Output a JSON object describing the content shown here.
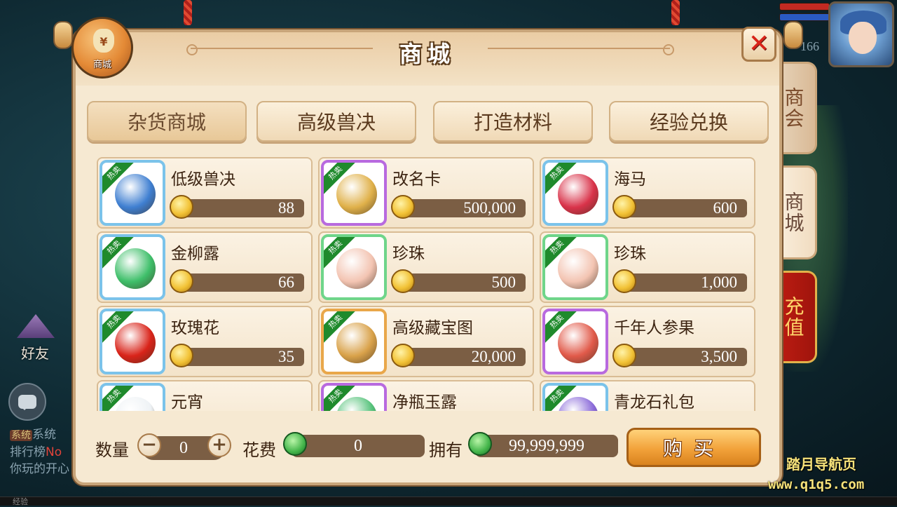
{
  "hud": {
    "level": "166"
  },
  "left_overlay": {
    "friend_label": "好友",
    "chat_lines": [
      {
        "tag": "系统",
        "text": "系统"
      },
      {
        "prefix": "排行榜",
        "highlight": "No"
      },
      {
        "text": "你玩的开心"
      }
    ]
  },
  "watermark": {
    "line1": "踏月导航页",
    "line2": "www.q1q5.com"
  },
  "exp_label": "经验",
  "shop": {
    "title": "商城",
    "badge": {
      "symbol": "¥",
      "label": "商城"
    },
    "close": "✕",
    "categories": [
      "杂货商城",
      "高级兽决",
      "打造材料",
      "经验兑换"
    ],
    "side_tabs": [
      "商会",
      "商城",
      "充值"
    ],
    "hot_tag": "热卖",
    "items": [
      {
        "name": "低级兽决",
        "price": "88",
        "frame": "blue",
        "icon": "beast-book-icon",
        "color": "#3f7fd1"
      },
      {
        "name": "改名卡",
        "price": "500,000",
        "frame": "purple",
        "icon": "scroll-icon",
        "color": "#e0b14a"
      },
      {
        "name": "海马",
        "price": "600",
        "frame": "blue",
        "icon": "seahorse-icon",
        "color": "#d9334a"
      },
      {
        "name": "金柳露",
        "price": "66",
        "frame": "blue",
        "icon": "potion-gourd-icon",
        "color": "#3fbf6a"
      },
      {
        "name": "珍珠",
        "price": "500",
        "frame": "green",
        "icon": "pearl-icon",
        "color": "#f3c4b2"
      },
      {
        "name": "珍珠",
        "price": "1,000",
        "frame": "green",
        "icon": "pearl-icon",
        "color": "#f3c4b2"
      },
      {
        "name": "玫瑰花",
        "price": "35",
        "frame": "blue",
        "icon": "rose-icon",
        "color": "#d9241a"
      },
      {
        "name": "高级藏宝图",
        "price": "20,000",
        "frame": "orange",
        "icon": "treasure-map-icon",
        "color": "#d9a24a"
      },
      {
        "name": "千年人参果",
        "price": "3,500",
        "frame": "purple",
        "icon": "ginseng-fruit-icon",
        "color": "#e15a4a"
      },
      {
        "name": "元宵",
        "price": "",
        "frame": "blue",
        "icon": "rice-ball-icon",
        "color": "#eef2f5"
      },
      {
        "name": "净瓶玉露",
        "price": "",
        "frame": "purple",
        "icon": "jade-vase-icon",
        "color": "#55c27a"
      },
      {
        "name": "青龙石礼包",
        "price": "",
        "frame": "blue",
        "icon": "gift-pack-icon",
        "color": "#8a6ad9"
      }
    ],
    "bottom": {
      "qty_label": "数量",
      "qty_value": "0",
      "minus": "−",
      "plus": "+",
      "cost_label": "花费",
      "cost_value": "0",
      "own_label": "拥有",
      "own_value": "99,999,999",
      "buy_label": "购买"
    }
  }
}
